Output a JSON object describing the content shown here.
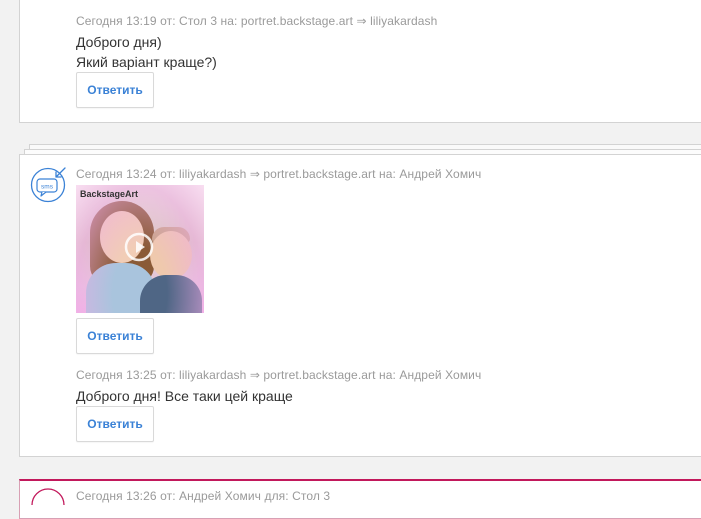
{
  "messages": [
    {
      "meta": "Сегодня 13:19 от: Стол 3 на: portret.backstage.art ⇒ liliyakardash",
      "lines": [
        "Доброго дня)",
        "Який варіант краще?)"
      ],
      "reply_label": "Ответить"
    },
    {
      "meta": "Сегодня 13:24 от: liliyakardash ⇒ portret.backstage.art на: Андрей Хомич",
      "image_logo": "BackstageArt",
      "reply_label": "Ответить"
    },
    {
      "meta": "Сегодня 13:25 от: liliyakardash ⇒ portret.backstage.art на: Андрей Хомич",
      "lines": [
        "Доброго дня! Все таки цей краще"
      ],
      "reply_label": "Ответить"
    },
    {
      "meta": "Сегодня 13:26 от: Андрей Хомич для: Стол 3"
    }
  ],
  "icons": {
    "sms_badge": "sms",
    "incoming_arrow": "arrow-incoming-icon"
  },
  "colors": {
    "accent_link": "#3b82d6",
    "meta_text": "#9a9a9a",
    "icon_blue": "#3b82d6",
    "outgoing_border": "#c2185b"
  }
}
